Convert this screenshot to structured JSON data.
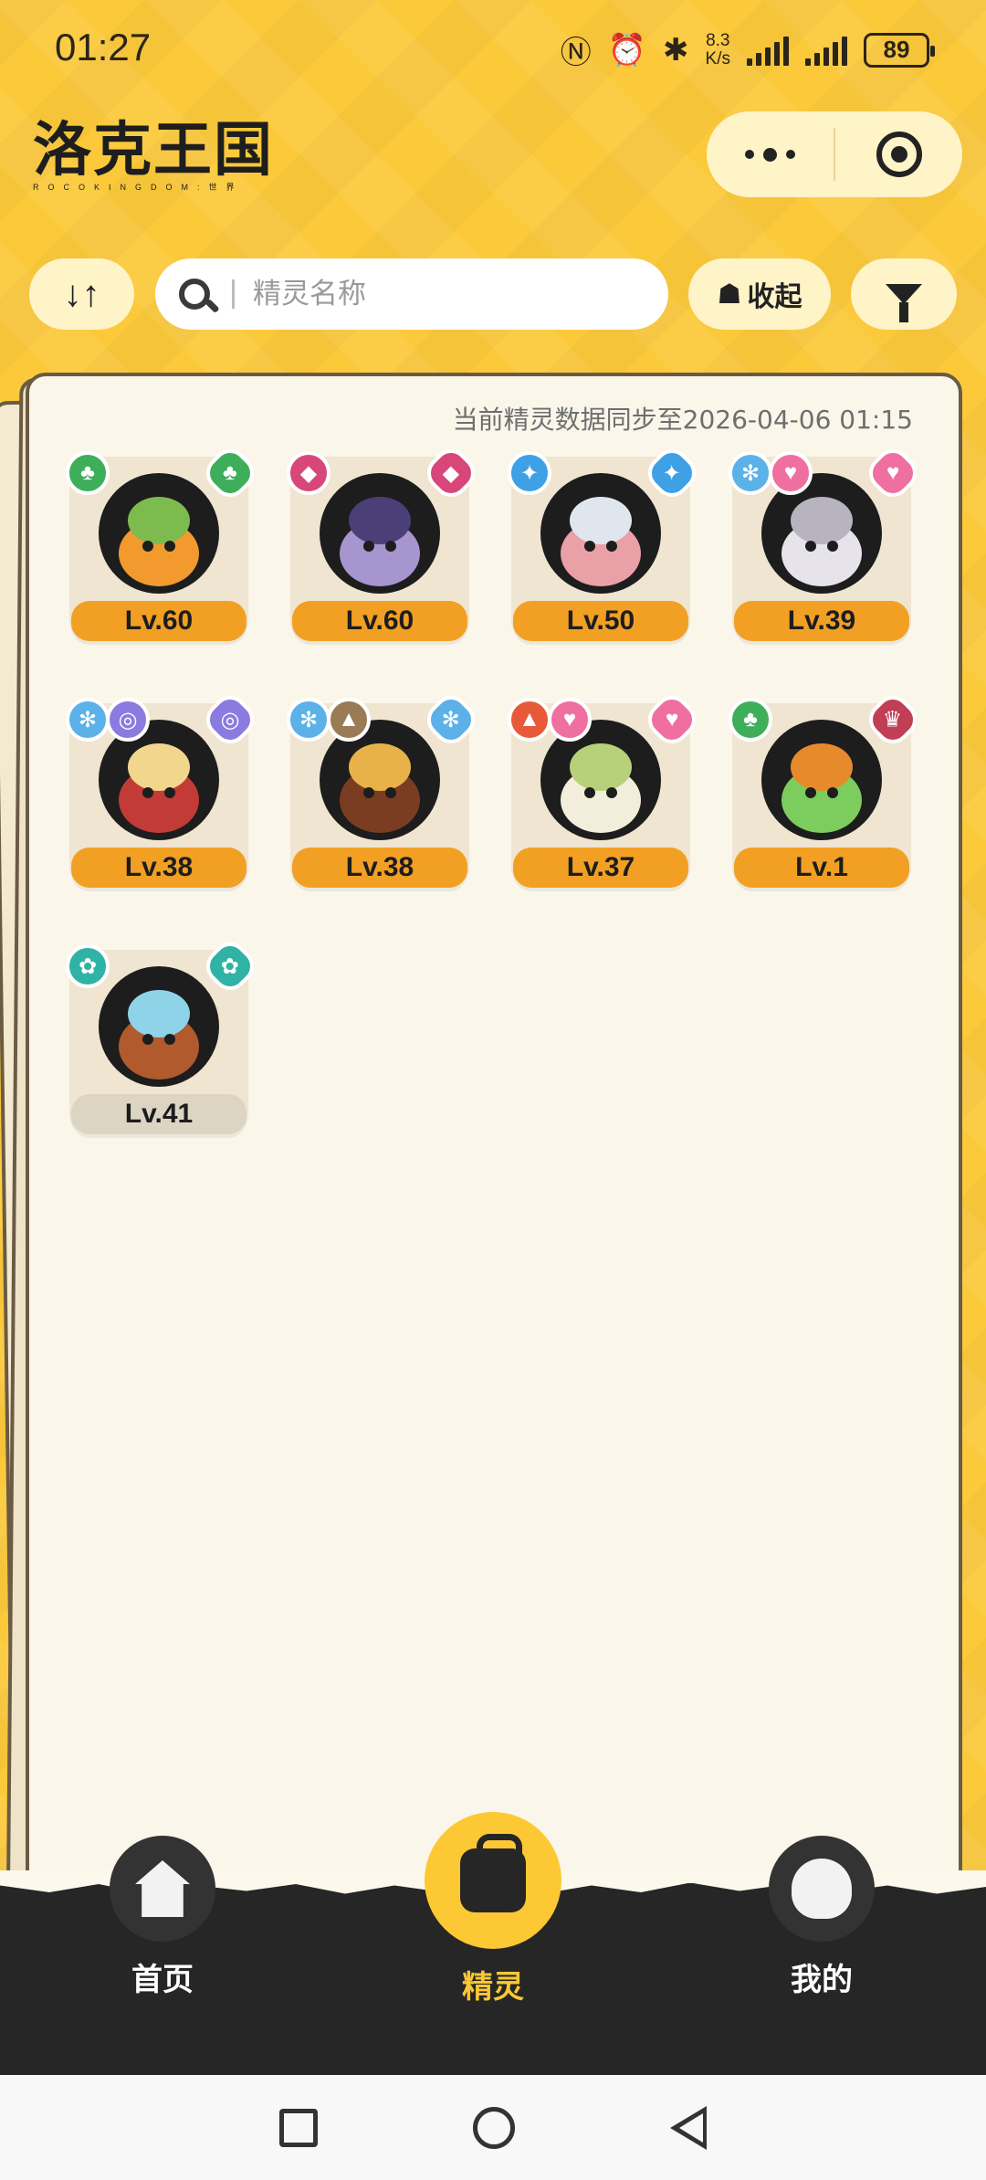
{
  "status_bar": {
    "time": "01:27",
    "net_speed_value": "8.3",
    "net_speed_unit": "K/s",
    "battery": "89"
  },
  "header": {
    "logo_text": "洛克王国",
    "logo_subtitle": "ROCOKINGDOM:世界"
  },
  "toolbar": {
    "sort_icon": "↓↑",
    "search_placeholder": "精灵名称",
    "collect_label": "收起",
    "filter_icon": "filter-icon"
  },
  "main": {
    "sync_text": "当前精灵数据同步至2026-04-06 01:15",
    "pets": [
      {
        "level": "Lv.60",
        "badges_left": [
          {
            "color": "#3fae5a",
            "glyph": "♣"
          }
        ],
        "badge_right": {
          "color": "#3fae5a",
          "glyph": "♣"
        },
        "colors": [
          "#f29a2e",
          "#7dbb4f"
        ]
      },
      {
        "level": "Lv.60",
        "badges_left": [
          {
            "color": "#d9477a",
            "glyph": "◆"
          }
        ],
        "badge_right": {
          "color": "#d9477a",
          "glyph": "◆"
        },
        "colors": [
          "#a695cf",
          "#4b3f78"
        ]
      },
      {
        "level": "Lv.50",
        "badges_left": [
          {
            "color": "#3ea1e6",
            "glyph": "✦"
          }
        ],
        "badge_right": {
          "color": "#3ea1e6",
          "glyph": "✦"
        },
        "colors": [
          "#e9a0a6",
          "#dfe6ee"
        ]
      },
      {
        "level": "Lv.39",
        "badges_left": [
          {
            "color": "#5bb1e8",
            "glyph": "✻"
          },
          {
            "color": "#ef6fa0",
            "glyph": "♥"
          }
        ],
        "badge_right": {
          "color": "#ef6fa0",
          "glyph": "♥"
        },
        "colors": [
          "#e6e4ea",
          "#b7b4c0"
        ]
      },
      {
        "level": "Lv.38",
        "badges_left": [
          {
            "color": "#5bb1e8",
            "glyph": "✻"
          },
          {
            "color": "#8b7ae0",
            "glyph": "◎"
          }
        ],
        "badge_right": {
          "color": "#8b7ae0",
          "glyph": "◎"
        },
        "colors": [
          "#c33b36",
          "#f3d68e"
        ]
      },
      {
        "level": "Lv.38",
        "badges_left": [
          {
            "color": "#5bb1e8",
            "glyph": "✻"
          },
          {
            "color": "#9a7b55",
            "glyph": "▲"
          }
        ],
        "badge_right": {
          "color": "#5bb1e8",
          "glyph": "✻"
        },
        "colors": [
          "#7a3d22",
          "#e8b14a"
        ]
      },
      {
        "level": "Lv.37",
        "badges_left": [
          {
            "color": "#e8593a",
            "glyph": "▲"
          },
          {
            "color": "#ef6fa0",
            "glyph": "♥"
          }
        ],
        "badge_right": {
          "color": "#ef6fa0",
          "glyph": "♥"
        },
        "colors": [
          "#f3eedc",
          "#b7d07a"
        ]
      },
      {
        "level": "Lv.1",
        "badges_left": [
          {
            "color": "#3fae5a",
            "glyph": "♣"
          }
        ],
        "badge_right": {
          "color": "#c23e55",
          "glyph": "♛"
        },
        "colors": [
          "#7ccc5e",
          "#e78a2c"
        ]
      },
      {
        "level": "Lv.41",
        "badges_left": [
          {
            "color": "#2fb3a5",
            "glyph": "✿"
          }
        ],
        "badge_right": {
          "color": "#2fb3a5",
          "glyph": "✿"
        },
        "colors": [
          "#b05a2e",
          "#8fd3e8"
        ],
        "grey": true
      }
    ]
  },
  "tab_bar": {
    "items": [
      {
        "label": "首页",
        "icon": "home-icon",
        "active": false
      },
      {
        "label": "精灵",
        "icon": "bag-icon",
        "active": true
      },
      {
        "label": "我的",
        "icon": "profile-icon",
        "active": false
      }
    ]
  },
  "colors": {
    "background": "#fbc93a",
    "level_pill": "#f1a024",
    "active_tab": "#fcc833",
    "tab_bar": "#262626"
  }
}
